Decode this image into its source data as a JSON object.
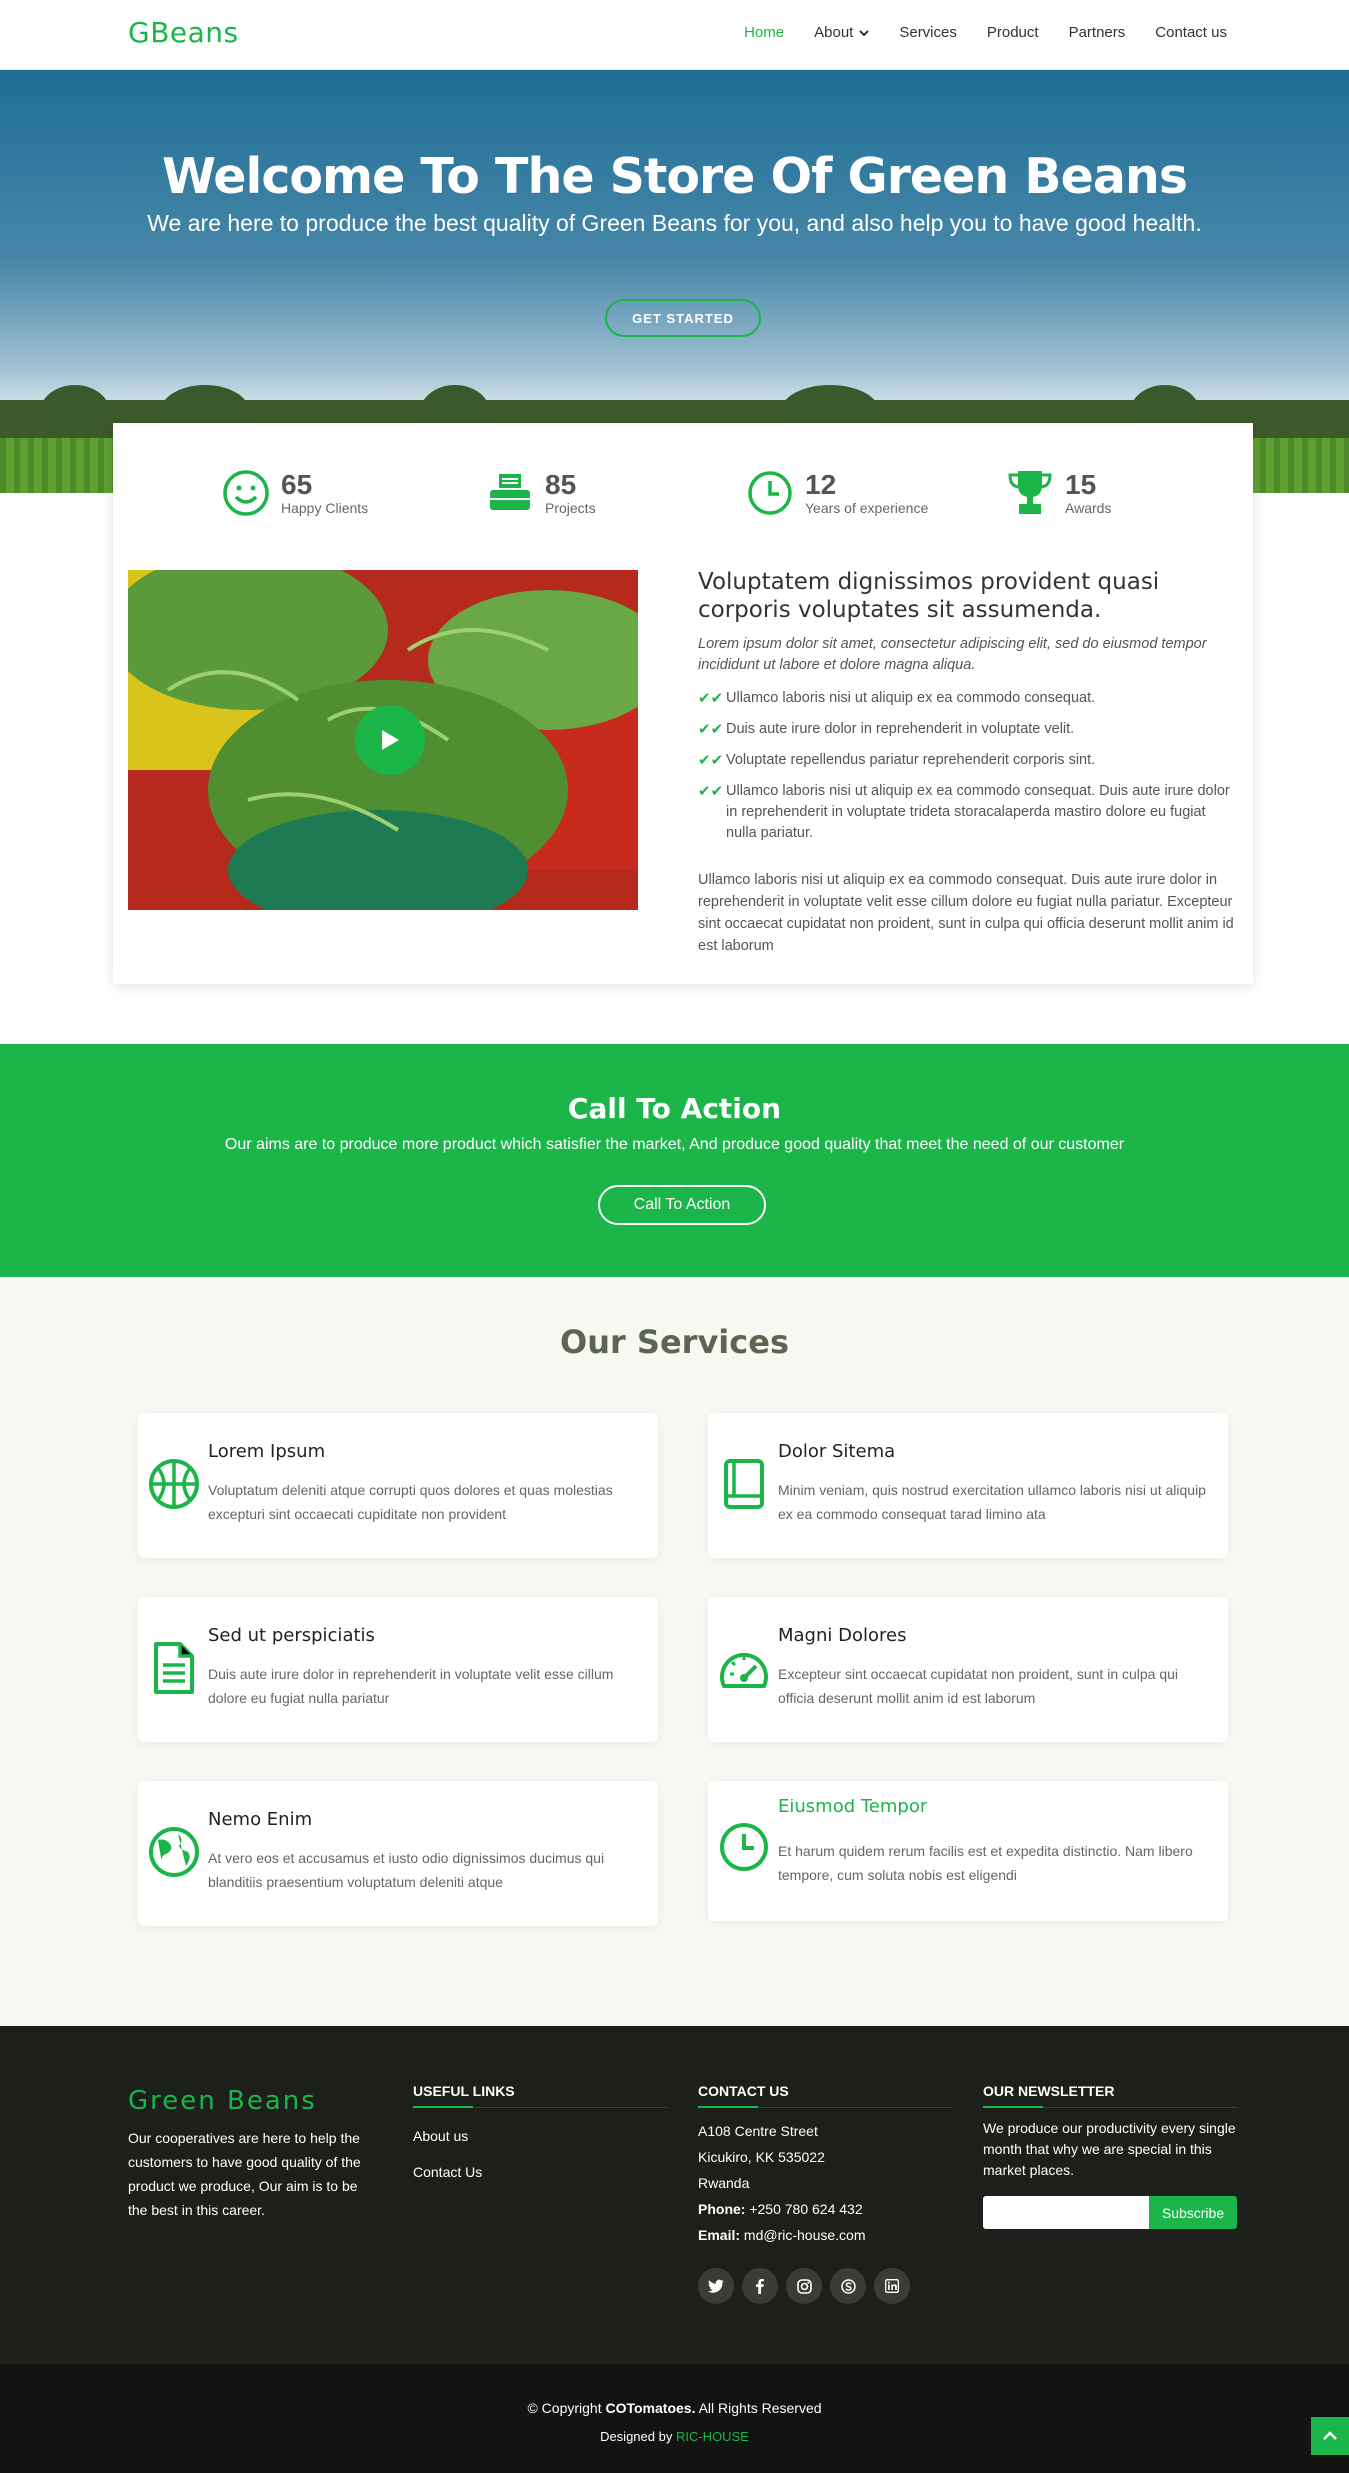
{
  "header": {
    "logo": "GBeans",
    "nav": [
      "Home",
      "About",
      "Services",
      "Product",
      "Partners",
      "Contact us"
    ]
  },
  "hero": {
    "title": "Welcome To The Store Of Green Beans",
    "subtitle": "We are here to produce the best quality of Green Beans for you, and also help you to have good health.",
    "button": "GET STARTED"
  },
  "counts": [
    {
      "number": "65",
      "label": "Happy Clients",
      "icon": "smile-icon"
    },
    {
      "number": "85",
      "label": "Projects",
      "icon": "printer-icon"
    },
    {
      "number": "12",
      "label": "Years of experience",
      "icon": "clock-icon"
    },
    {
      "number": "15",
      "label": "Awards",
      "icon": "trophy-icon"
    }
  ],
  "about": {
    "title": "Voluptatem dignissimos provident quasi corporis voluptates sit assumenda.",
    "lead": "Lorem ipsum dolor sit amet, consectetur adipiscing elit, sed do eiusmod tempor incididunt ut labore et dolore magna aliqua.",
    "items": [
      "Ullamco laboris nisi ut aliquip ex ea commodo consequat.",
      "Duis aute irure dolor in reprehenderit in voluptate velit.",
      "Voluptate repellendus pariatur reprehenderit corporis sint.",
      "Ullamco laboris nisi ut aliquip ex ea commodo consequat. Duis aute irure dolor in reprehenderit in voluptate trideta storacalaperda mastiro dolore eu fugiat nulla pariatur."
    ],
    "paragraph": "Ullamco laboris nisi ut aliquip ex ea commodo consequat. Duis aute irure dolor in reprehenderit in voluptate velit esse cillum dolore eu fugiat nulla pariatur. Excepteur sint occaecat cupidatat non proident, sunt in culpa qui officia deserunt mollit anim id est laborum"
  },
  "cta": {
    "title": "Call To Action",
    "text": "Our aims are to produce more product which satisfier the market, And produce good quality that meet the need of our customer",
    "button": "Call To Action"
  },
  "services": {
    "title": "Our Services",
    "items": [
      {
        "title": "Lorem Ipsum",
        "text": "Voluptatum deleniti atque corrupti quos dolores et quas molestias excepturi sint occaecati cupiditate non provident",
        "icon": "basketball-icon"
      },
      {
        "title": "Dolor Sitema",
        "text": "Minim veniam, quis nostrud exercitation ullamco laboris nisi ut aliquip ex ea commodo consequat tarad limino ata",
        "icon": "book-icon"
      },
      {
        "title": "Sed ut perspiciatis",
        "text": "Duis aute irure dolor in reprehenderit in voluptate velit esse cillum dolore eu fugiat nulla pariatur",
        "icon": "document-icon"
      },
      {
        "title": "Magni Dolores",
        "text": "Excepteur sint occaecat cupidatat non proident, sunt in culpa qui officia deserunt mollit anim id est laborum",
        "icon": "speedometer-icon"
      },
      {
        "title": "Nemo Enim",
        "text": "At vero eos et accusamus et iusto odio dignissimos ducimus qui blanditiis praesentium voluptatum deleniti atque",
        "icon": "globe-icon"
      },
      {
        "title": "Eiusmod Tempor",
        "text": "Et harum quidem rerum facilis est et expedita distinctio. Nam libero tempore, cum soluta nobis est eligendi",
        "icon": "clock-icon"
      }
    ]
  },
  "footer": {
    "logo": "Green Beans",
    "about": "Our cooperatives are here to help the customers to have good quality of the product we produce, Our aim is to be the best in this career.",
    "useful_links": {
      "title": "USEFUL LINKS",
      "links": [
        "About us",
        "Contact Us"
      ]
    },
    "contact": {
      "title": "CONTACT US",
      "line1": "A108 Centre Street",
      "line2": "Kicukiro, KK 535022",
      "line3": "Rwanda",
      "phone_label": "Phone:",
      "phone": "+250 780 624 432",
      "email_label": "Email:",
      "email": "md@ric-house.com"
    },
    "newsletter": {
      "title": "OUR NEWSLETTER",
      "text": "We produce our productivity every single month that why we are special in this market places.",
      "button": "Subscribe"
    }
  },
  "bottom": {
    "copyright_prefix": "© Copyright",
    "brand": "COTomatoes.",
    "rights": "All Rights Reserved",
    "designed_by": "Designed by",
    "designer": "RIC-HOUSE"
  },
  "colors": {
    "accent": "#1bb54a",
    "footer_bg": "#1c1f1a",
    "services_bg": "#f7f8f2"
  }
}
